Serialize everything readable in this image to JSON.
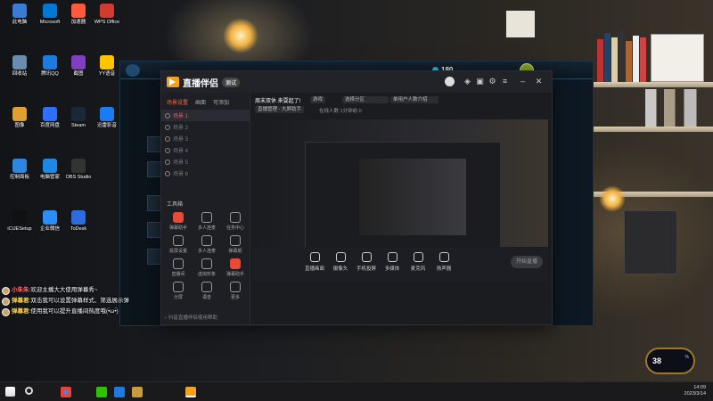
{
  "desktop_icons": [
    {
      "label": "此电脑",
      "color": "#3a7bd5"
    },
    {
      "label": "回收站",
      "color": "#6a8caf"
    },
    {
      "label": "图像",
      "color": "#e0a030"
    },
    {
      "label": "控制面板",
      "color": "#2e86de"
    },
    {
      "label": "iCUESetup",
      "color": "#111"
    },
    {
      "label": "Microsoft",
      "color": "#0078d4"
    },
    {
      "label": "腾讯QQ",
      "color": "#1f7ae0"
    },
    {
      "label": "百度网盘",
      "color": "#2f6fff"
    },
    {
      "label": "电脑管家",
      "color": "#1e88e5"
    },
    {
      "label": "企业微信",
      "color": "#2c8ef8"
    },
    {
      "label": "加速器",
      "color": "#ff5a3c"
    },
    {
      "label": "截图",
      "color": "#7f3fbf"
    },
    {
      "label": "Steam",
      "color": "#1b2838"
    },
    {
      "label": "OBS Studio",
      "color": "#333"
    },
    {
      "label": "ToDesk",
      "color": "#2d6cdf"
    },
    {
      "label": "WPS Office",
      "color": "#d23b2f"
    },
    {
      "label": "YY语音",
      "color": "#ffc400"
    },
    {
      "label": "迅雷影音",
      "color": "#1a7cf2"
    }
  ],
  "game_client": {
    "currency": "180"
  },
  "app": {
    "title": "直播伴侣",
    "version": "测试",
    "left_tabs": [
      "场景设置",
      "画面",
      "可添加"
    ],
    "scenes": [
      "场景 1",
      "场景 2",
      "场景 3",
      "场景 4",
      "场景 5",
      "场景 6"
    ],
    "selected_scene": "场景 1",
    "tools_title": "工具箱",
    "tools": [
      "弹幕助手",
      "多人连麦",
      "任务中心",
      "投屏设置",
      "多人连麦",
      "弹幕姬",
      "直播间",
      "虚拟形象",
      "弹幕助手",
      "分屏",
      "语音",
      "更多"
    ],
    "stream_title": "周末双休 来耍起了!",
    "chips": [
      "游戏",
      "选择分区",
      "单用户人数介绍",
      "直播管理 · 大屏助手"
    ],
    "online": "在线人数 1分钟前 0",
    "bottom_buttons": [
      "直播画面",
      "摄像头",
      "手机投屏",
      "多媒体",
      "麦克风",
      "扬声器"
    ],
    "start_label": "开始直播",
    "bottom_tip": "○ 抖音直播伴侣使用帮助"
  },
  "chat": [
    {
      "name": "小朱朱",
      "name_color": "#ff6b6b",
      "text": "欢迎主播大大使用弹幕秀~"
    },
    {
      "name": "弹幕君",
      "name_color": "#ffd24a",
      "text": "双击我可以设置弹幕样式、筛选展示弹"
    },
    {
      "name": "弹幕君",
      "name_color": "#ffd24a",
      "text": "使用我可以提升直播间热度哦(•̀ω•́)"
    }
  ],
  "perf": {
    "value": "38",
    "unit": "%"
  },
  "taskbar": {
    "time": "14:09",
    "date": "2023/3/14"
  }
}
